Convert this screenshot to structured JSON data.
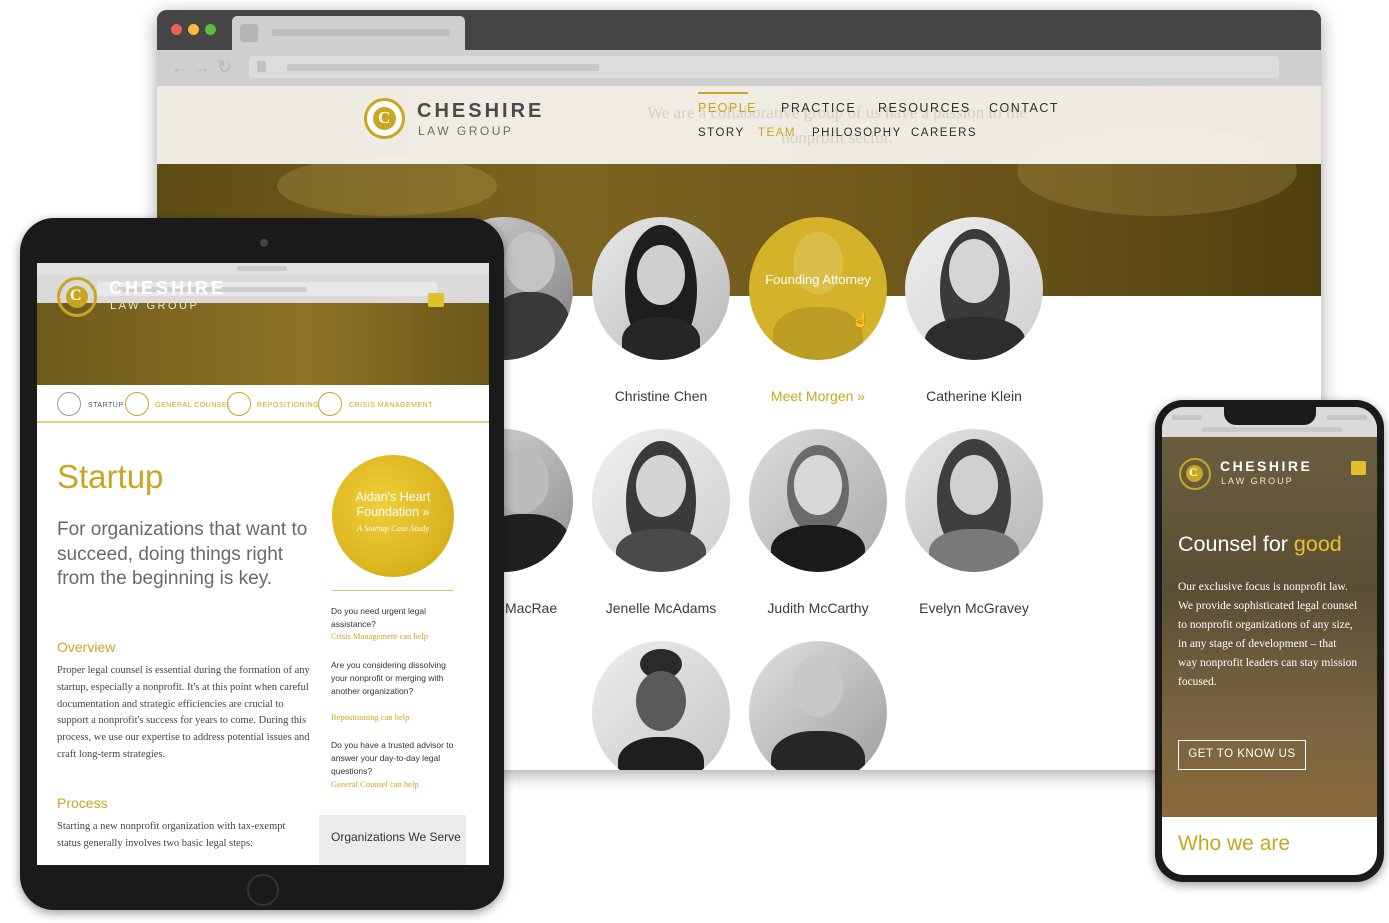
{
  "colors": {
    "gold": "#c9a620",
    "dark": "#3a3a3a",
    "hero": "#6e5a1b"
  },
  "desktop": {
    "ghost_text": "We are a collaborative group of us have a passion to the nonprofit sector.",
    "logo": {
      "name": "CHESHIRE",
      "sub": "LAW GROUP",
      "icon": "cheshire-c-logo"
    },
    "nav_top": [
      "PEOPLE",
      "PRACTICE",
      "RESOURCES",
      "CONTACT"
    ],
    "nav_sub": [
      "STORY",
      "TEAM",
      "PHILOSOPHY",
      "CAREERS"
    ],
    "people": [
      {
        "name": "Adawi"
      },
      {
        "name": "Christine Chen"
      },
      {
        "name": "Meet Morgen »",
        "overlay": "Founding Attorney"
      },
      {
        "name": "Catherine Klein"
      },
      {
        "name": "MacRae"
      },
      {
        "name": "Jenelle McAdams"
      },
      {
        "name": "Judith McCarthy"
      },
      {
        "name": "Evelyn McGravey"
      }
    ]
  },
  "tablet": {
    "logo": {
      "name": "CHESHIRE",
      "sub": "LAW GROUP"
    },
    "services": [
      "STARTUP",
      "GENERAL COUNSEL",
      "REPOSITIONING",
      "CRISIS MANAGEMENT"
    ],
    "title": "Startup",
    "lead": "For organizations that want to succeed, doing things right from the beginning is key.",
    "overview_h": "Overview",
    "overview_p": "Proper legal counsel is essential during the formation of any startup, especially a nonprofit. It's at this point when careful documentation and strategic efficiencies are crucial to support a nonprofit's success for years to come. During this process, we use our expertise to address potential issues and craft long-term strategies.",
    "process_h": "Process",
    "process_p": "Starting a new nonprofit organization with tax-exempt status generally involves two basic legal steps:",
    "case_title": "Aidan's Heart Foundation »",
    "case_sub": "A Startup Case Study",
    "questions": [
      {
        "q": "Do you need urgent legal assistance?",
        "link": "Crisis Management can help"
      },
      {
        "q": "Are you considering dissolving your nonprofit or merging with another organization?",
        "link": "Repositioning can help"
      },
      {
        "q": "Do you have a trusted advisor to answer your day-to-day legal questions?",
        "link": "General Counsel can help"
      }
    ],
    "orgs": "Organizations We Serve"
  },
  "phone": {
    "logo": {
      "name": "CHESHIRE",
      "sub": "LAW GROUP"
    },
    "title_a": "Counsel for ",
    "title_b": "good",
    "body": "Our exclusive focus is nonprofit law. We provide sophisticated legal counsel to nonprofit organizations of any size, in any stage of development – that way nonprofit leaders can stay mission focused.",
    "button": "GET TO KNOW US",
    "who": "Who we are"
  }
}
